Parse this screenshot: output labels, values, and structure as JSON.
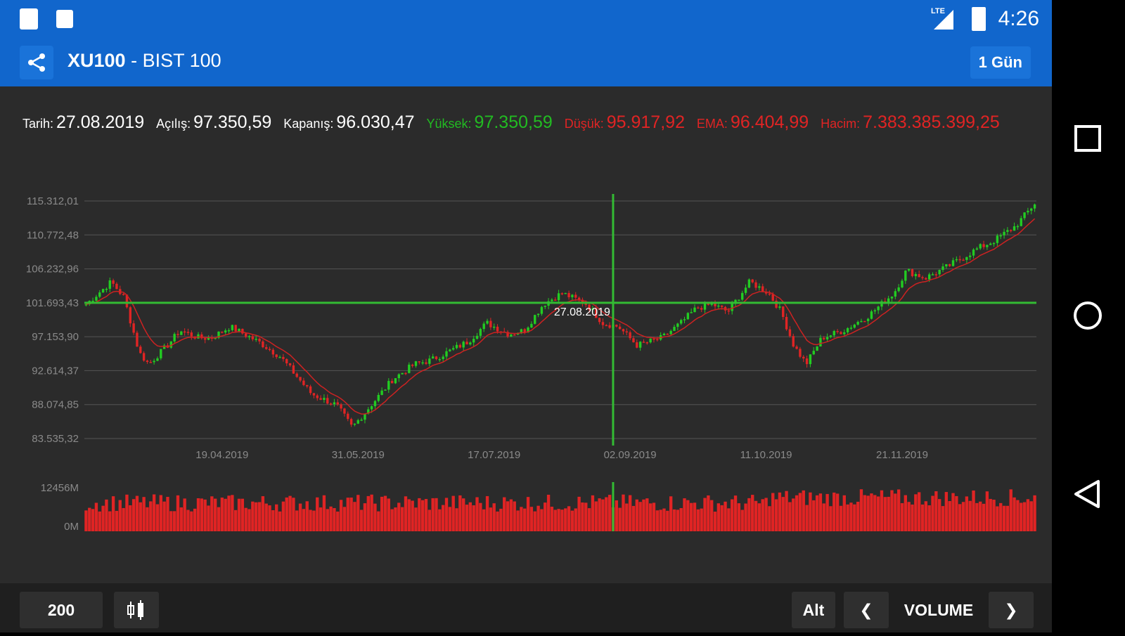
{
  "status_bar": {
    "time": "4:26",
    "network_label": "LTE"
  },
  "app_bar": {
    "symbol": "XU100",
    "separator": " - ",
    "name": "BIST 100",
    "period_button": "1 Gün"
  },
  "info_line": {
    "date_label": "Tarih:",
    "date_value": "27.08.2019",
    "open_label": "Açılış:",
    "open_value": "97.350,59",
    "close_label": "Kapanış:",
    "close_value": "96.030,47",
    "high_label": "Yüksek:",
    "high_value": "97.350,59",
    "low_label": "Düşük:",
    "low_value": "95.917,92",
    "ema_label": "EMA:",
    "ema_value": "96.404,99",
    "volume_label": "Hacim:",
    "volume_value": "7.383.385.399,25"
  },
  "colors": {
    "up": "#22cc22",
    "down": "#e02424",
    "accent": "#1166cc",
    "crosshair": "#33bb33",
    "ema": "#cc2222"
  },
  "chart_data": [
    {
      "type": "candlestick",
      "y_tick_labels": [
        "115.312,01",
        "110.772,48",
        "106.232,96",
        "101.693,43",
        "97.153,90",
        "92.614,37",
        "88.074,85",
        "83.535,32"
      ],
      "y_ticks": [
        115312.01,
        110772.48,
        106232.96,
        101693.43,
        97153.9,
        92614.37,
        88074.85,
        83535.32
      ],
      "ylim": [
        83535.32,
        115312.01
      ],
      "x_tick_labels": [
        "19.04.2019",
        "31.05.2019",
        "17.07.2019",
        "02.09.2019",
        "11.10.2019",
        "21.11.2019"
      ],
      "x_tick_index": [
        40,
        80,
        120,
        160,
        200,
        240
      ],
      "n_points": 280,
      "crosshair": {
        "label": "27.08.2019",
        "index": 155,
        "value": 101693.43
      },
      "close_anchors": [
        [
          0,
          101500
        ],
        [
          8,
          104500
        ],
        [
          12,
          102500
        ],
        [
          17,
          95000
        ],
        [
          20,
          93500
        ],
        [
          26,
          96000
        ],
        [
          30,
          98000
        ],
        [
          36,
          97000
        ],
        [
          40,
          97000
        ],
        [
          46,
          98500
        ],
        [
          55,
          96500
        ],
        [
          62,
          94500
        ],
        [
          72,
          89500
        ],
        [
          80,
          88000
        ],
        [
          85,
          85000
        ],
        [
          90,
          87500
        ],
        [
          98,
          91500
        ],
        [
          105,
          93500
        ],
        [
          110,
          94000
        ],
        [
          115,
          95000
        ],
        [
          122,
          96500
        ],
        [
          128,
          99000
        ],
        [
          135,
          97500
        ],
        [
          140,
          98000
        ],
        [
          146,
          101500
        ],
        [
          152,
          103000
        ],
        [
          160,
          101500
        ],
        [
          165,
          99000
        ],
        [
          170,
          98500
        ],
        [
          176,
          96000
        ],
        [
          184,
          97000
        ],
        [
          190,
          99000
        ],
        [
          195,
          101000
        ],
        [
          200,
          101500
        ],
        [
          205,
          100500
        ],
        [
          212,
          104500
        ],
        [
          218,
          103000
        ],
        [
          222,
          100500
        ],
        [
          226,
          96000
        ],
        [
          230,
          93500
        ],
        [
          235,
          97000
        ],
        [
          242,
          98000
        ],
        [
          250,
          100000
        ],
        [
          258,
          103000
        ],
        [
          262,
          106000
        ],
        [
          268,
          105000
        ],
        [
          275,
          106500
        ],
        [
          285,
          109000
        ],
        [
          290,
          110000
        ],
        [
          297,
          112000
        ],
        [
          303,
          115000
        ]
      ]
    },
    {
      "type": "bar",
      "title": "VOLUME",
      "y_tick_labels": [
        "12456M",
        "0M"
      ],
      "ylim": [
        0,
        12456
      ]
    }
  ],
  "bottom_bar": {
    "period_count": "200",
    "alt_button": "Alt",
    "prev_glyph": "❮",
    "indicator_label": "VOLUME",
    "next_glyph": "❯"
  }
}
